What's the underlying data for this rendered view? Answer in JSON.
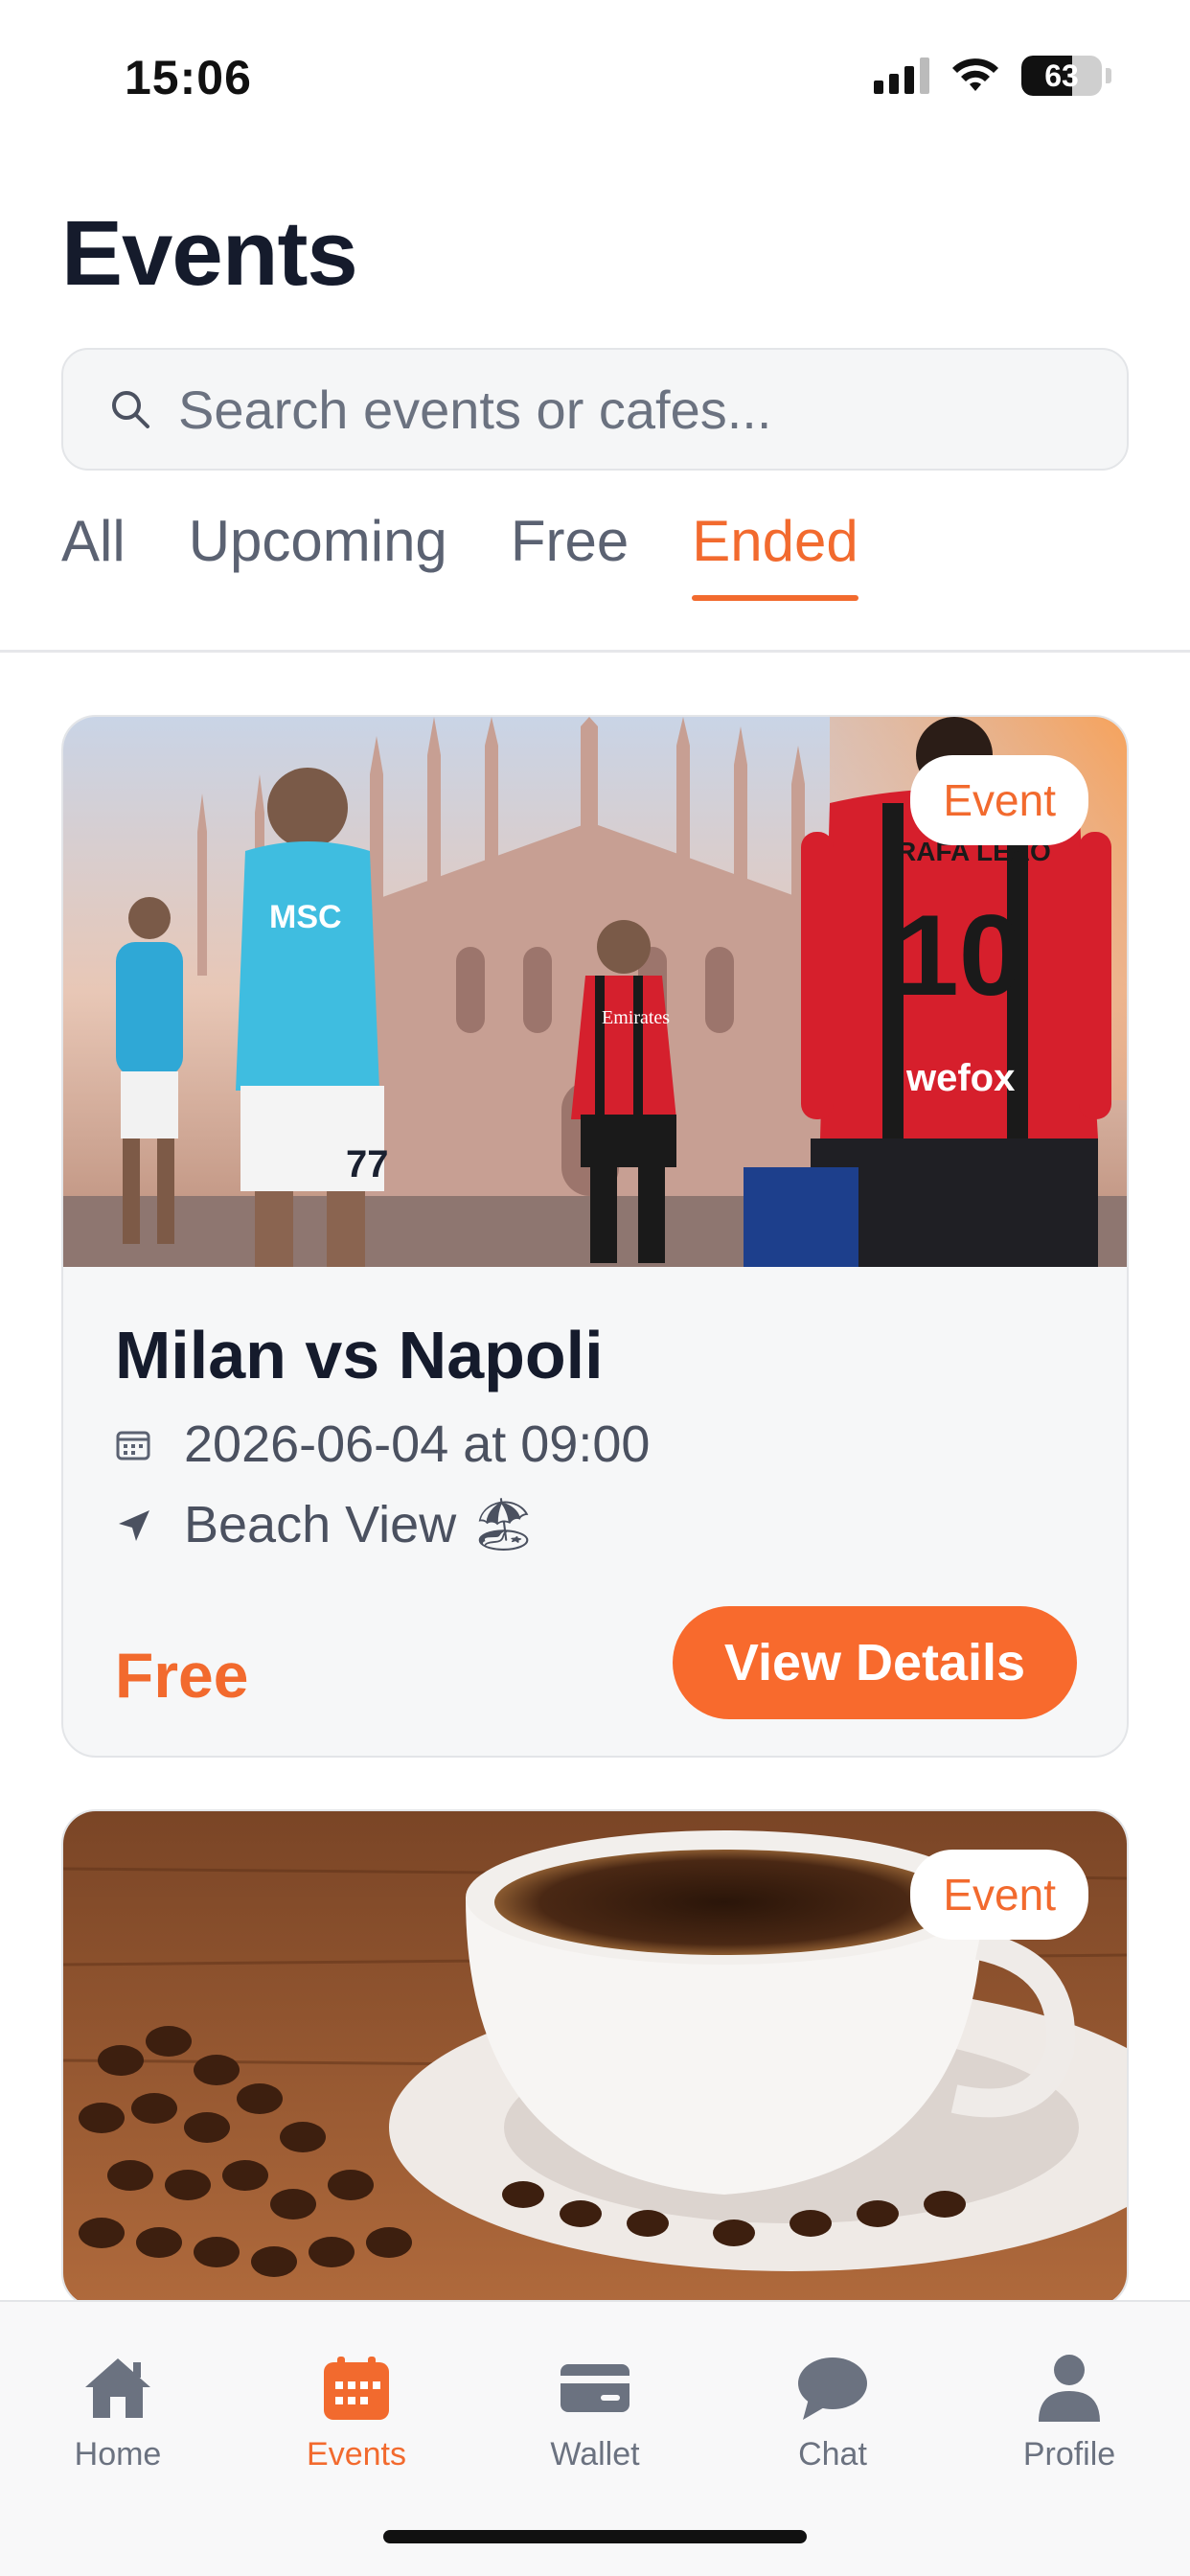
{
  "status_bar": {
    "time": "15:06",
    "battery_level": "63",
    "battery_fraction": 0.63
  },
  "header": {
    "title": "Events"
  },
  "search": {
    "placeholder": "Search events or cafes..."
  },
  "tabs": [
    {
      "label": "All",
      "active": false
    },
    {
      "label": "Upcoming",
      "active": false
    },
    {
      "label": "Free",
      "active": false
    },
    {
      "label": "Ended",
      "active": true
    }
  ],
  "events": [
    {
      "badge": "Event",
      "title": "Milan vs Napoli",
      "datetime": "2026-06-04 at 09:00",
      "location": "Beach View 🏖",
      "price": "Free",
      "button_label": "View Details",
      "image": "football-poster"
    },
    {
      "badge": "Event",
      "image": "coffee-cup"
    }
  ],
  "bottom_nav": [
    {
      "label": "Home",
      "icon": "home-icon",
      "active": false
    },
    {
      "label": "Events",
      "icon": "calendar-icon",
      "active": true
    },
    {
      "label": "Wallet",
      "icon": "wallet-icon",
      "active": false
    },
    {
      "label": "Chat",
      "icon": "chat-icon",
      "active": false
    },
    {
      "label": "Profile",
      "icon": "person-icon",
      "active": false
    }
  ],
  "colors": {
    "accent": "#f26a2e",
    "title": "#151b2c",
    "muted": "#6b7280"
  }
}
